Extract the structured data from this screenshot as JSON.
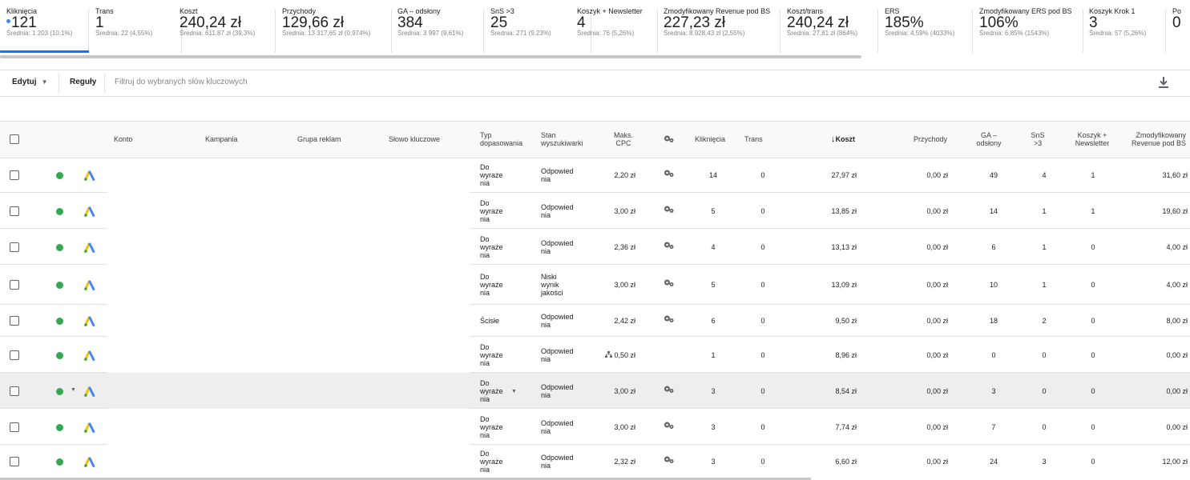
{
  "metrics": [
    {
      "label": "Kliknięcia",
      "value": "121",
      "avg": "Średnia: 1 203 (10,1%)",
      "selected": true
    },
    {
      "label": "Trans",
      "value": "1",
      "avg": "Średnia: 22 (4,55%)"
    },
    {
      "label": "Koszt",
      "value": "240,24 zł",
      "avg": "Średnia: 611,87 zł (39,3%)"
    },
    {
      "label": "Przychody",
      "value": "129,66 zł",
      "avg": "Średnia: 13 317,65 zł (0,974%)"
    },
    {
      "label": "GA – odsłony",
      "value": "384",
      "avg": "Średnia: 3 997 (9,61%)"
    },
    {
      "label": "SnS >3",
      "value": "25",
      "avg": "Średnia: 271 (9,23%)"
    },
    {
      "label": "Koszyk + Newsletter",
      "value": "4",
      "avg": "Średnia: 76 (5,26%)"
    },
    {
      "label": "Zmodyfikowany Revenue pod BS",
      "value": "227,23 zł",
      "avg": "Średnia: 8 928,43 zł (2,55%)"
    },
    {
      "label": "Koszt/trans",
      "value": "240,24 zł",
      "avg": "Średnia: 27,81 zł (864%)"
    },
    {
      "label": "ERS",
      "value": "185%",
      "avg": "Średnia: 4,59% (4033%)"
    },
    {
      "label": "Zmodyfikowany ERS pod BS",
      "value": "106%",
      "avg": "Średnia: 6,85% (1543%)"
    },
    {
      "label": "Koszyk Krok 1",
      "value": "3",
      "avg": "Średnia: 57 (5,26%)"
    },
    {
      "label": "Po",
      "value": "0",
      "avg": ""
    }
  ],
  "toolbar": {
    "edit_label": "Edytuj",
    "rules_label": "Reguły",
    "filter_placeholder": "Filtruj do wybranych słów kluczowych"
  },
  "table": {
    "headers": {
      "account": "Konto",
      "campaign": "Kampania",
      "ad_group": "Grupa reklam",
      "keyword": "Słowo kluczowe",
      "match_type": [
        "Typ",
        "dopasowania"
      ],
      "search_status": [
        "Stan",
        "wyszukiwarki"
      ],
      "max_cpc": [
        "Maks.",
        "CPC"
      ],
      "clicks": "Kliknięcia",
      "trans": "Trans",
      "cost": "Koszt",
      "revenue": "Przychody",
      "ga_views": [
        "GA –",
        "odsłony"
      ],
      "sns": [
        "SnS",
        ">3"
      ],
      "cart_newsletter": [
        "Koszyk +",
        "Newsletter"
      ],
      "mod_revenue": [
        "Zmodyfikowany",
        "Revenue pod BS"
      ]
    },
    "sort_arrow": "↓",
    "rows": [
      {
        "match": [
          "Do",
          "wyraże",
          "nia"
        ],
        "status": [
          "Odpowied",
          "nia"
        ],
        "cpc": "2,20 zł",
        "cpc_icon": "gear",
        "clicks": "14",
        "trans": "0",
        "cost": "27,97 zł",
        "revenue": "0,00 zł",
        "ga": "49",
        "sns": "4",
        "cart": "1",
        "modrev": "31,60 zł"
      },
      {
        "match": [
          "Do",
          "wyraże",
          "nia"
        ],
        "status": [
          "Odpowied",
          "nia"
        ],
        "cpc": "3,00 zł",
        "cpc_icon": "gear",
        "clicks": "5",
        "trans": "0",
        "cost": "13,85 zł",
        "revenue": "0,00 zł",
        "ga": "14",
        "sns": "1",
        "cart": "1",
        "modrev": "19,60 zł"
      },
      {
        "match": [
          "Do",
          "wyraże",
          "nia"
        ],
        "status": [
          "Odpowied",
          "nia"
        ],
        "cpc": "2,36 zł",
        "cpc_icon": "gear",
        "clicks": "4",
        "trans": "0",
        "cost": "13,13 zł",
        "revenue": "0,00 zł",
        "ga": "6",
        "sns": "1",
        "cart": "0",
        "modrev": "4,00 zł"
      },
      {
        "match": [
          "Do",
          "wyraże",
          "nia"
        ],
        "status": [
          "Niski",
          "wynik",
          "jakości"
        ],
        "cpc": "3,00 zł",
        "cpc_icon": "gear",
        "clicks": "5",
        "trans": "0",
        "cost": "13,09 zł",
        "revenue": "0,00 zł",
        "ga": "10",
        "sns": "1",
        "cart": "0",
        "modrev": "4,00 zł"
      },
      {
        "match": [
          "Ścisłe"
        ],
        "status": [
          "Odpowied",
          "nia"
        ],
        "cpc": "2,42 zł",
        "cpc_icon": "gear",
        "clicks": "6",
        "trans": "0",
        "cost": "9,50 zł",
        "revenue": "0,00 zł",
        "ga": "18",
        "sns": "2",
        "cart": "0",
        "modrev": "8,00 zł"
      },
      {
        "match": [
          "Do",
          "wyraże",
          "nia"
        ],
        "status": [
          "Odpowied",
          "nia"
        ],
        "cpc": "0,50 zł",
        "cpc_icon": "hierarchy",
        "clicks": "1",
        "trans": "0",
        "cost": "8,96 zł",
        "revenue": "0,00 zł",
        "ga": "0",
        "sns": "0",
        "cart": "0",
        "modrev": "0,00 zł"
      },
      {
        "match": [
          "Do",
          "wyraże",
          "nia"
        ],
        "status": [
          "Odpowied",
          "nia"
        ],
        "cpc": "3,00 zł",
        "cpc_icon": "gear",
        "clicks": "3",
        "trans": "0",
        "cost": "8,54 zł",
        "revenue": "0,00 zł",
        "ga": "3",
        "sns": "0",
        "cart": "0",
        "modrev": "0,00 zł",
        "highlight": true
      },
      {
        "match": [
          "Do",
          "wyraże",
          "nia"
        ],
        "status": [
          "Odpowied",
          "nia"
        ],
        "cpc": "3,00 zł",
        "cpc_icon": "gear",
        "clicks": "3",
        "trans": "0",
        "cost": "7,74 zł",
        "revenue": "0,00 zł",
        "ga": "7",
        "sns": "0",
        "cart": "0",
        "modrev": "0,00 zł"
      },
      {
        "match": [
          "Do",
          "wyraże",
          "nia"
        ],
        "status": [
          "Odpowied",
          "nia"
        ],
        "cpc": "2,32 zł",
        "cpc_icon": "gear",
        "clicks": "3",
        "trans": "0",
        "cost": "6,60 zł",
        "revenue": "0,00 zł",
        "ga": "24",
        "sns": "3",
        "cart": "0",
        "modrev": "12,00 zł"
      }
    ]
  },
  "colors": {
    "accent": "#1a73e8",
    "status_enabled": "#34a853",
    "ads_blue": "#4285f4",
    "ads_yellow": "#fbbc04",
    "ads_green": "#34a853"
  },
  "icons": {
    "status": "enabled-dot-icon",
    "ads": "google-ads-icon",
    "bid_strategy": "gear-icon",
    "portfolio": "hierarchy-icon",
    "download": "download-icon",
    "sort": "arrow-down-icon"
  }
}
